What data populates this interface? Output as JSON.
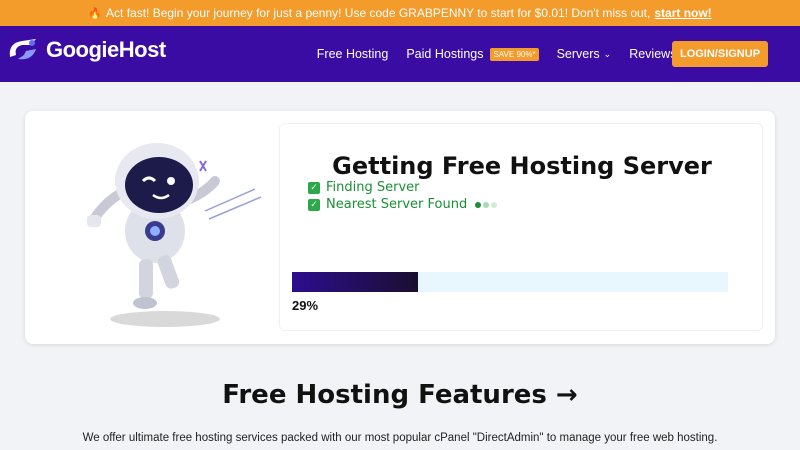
{
  "promo": {
    "icon": "fire-icon",
    "text": "Act fast! Begin your journey for just a penny! Use code GRABPENNY to start for $0.01! Don't miss out,",
    "link": "start now!",
    "bg_color": "#f39b2b"
  },
  "nav": {
    "logo_text": "GoogieHost",
    "brand_color": "#3a0ca3",
    "items": [
      {
        "label": "Free Hosting"
      },
      {
        "label": "Paid Hostings",
        "badge": "SAVE 90%*"
      },
      {
        "label": "Servers"
      },
      {
        "label": "Reviews"
      }
    ],
    "login_label": "LOGIN/SIGNUP"
  },
  "panel": {
    "title": "Getting Free Hosting Server",
    "steps": [
      {
        "label": "Finding Server"
      },
      {
        "label": "Nearest Server Found"
      }
    ],
    "progress_percent": 29,
    "progress_label": "29%"
  },
  "features": {
    "title": "Free Hosting Features →",
    "description": "We offer ultimate free hosting services packed with our most popular cPanel \"DirectAdmin\" to manage your free web hosting."
  }
}
